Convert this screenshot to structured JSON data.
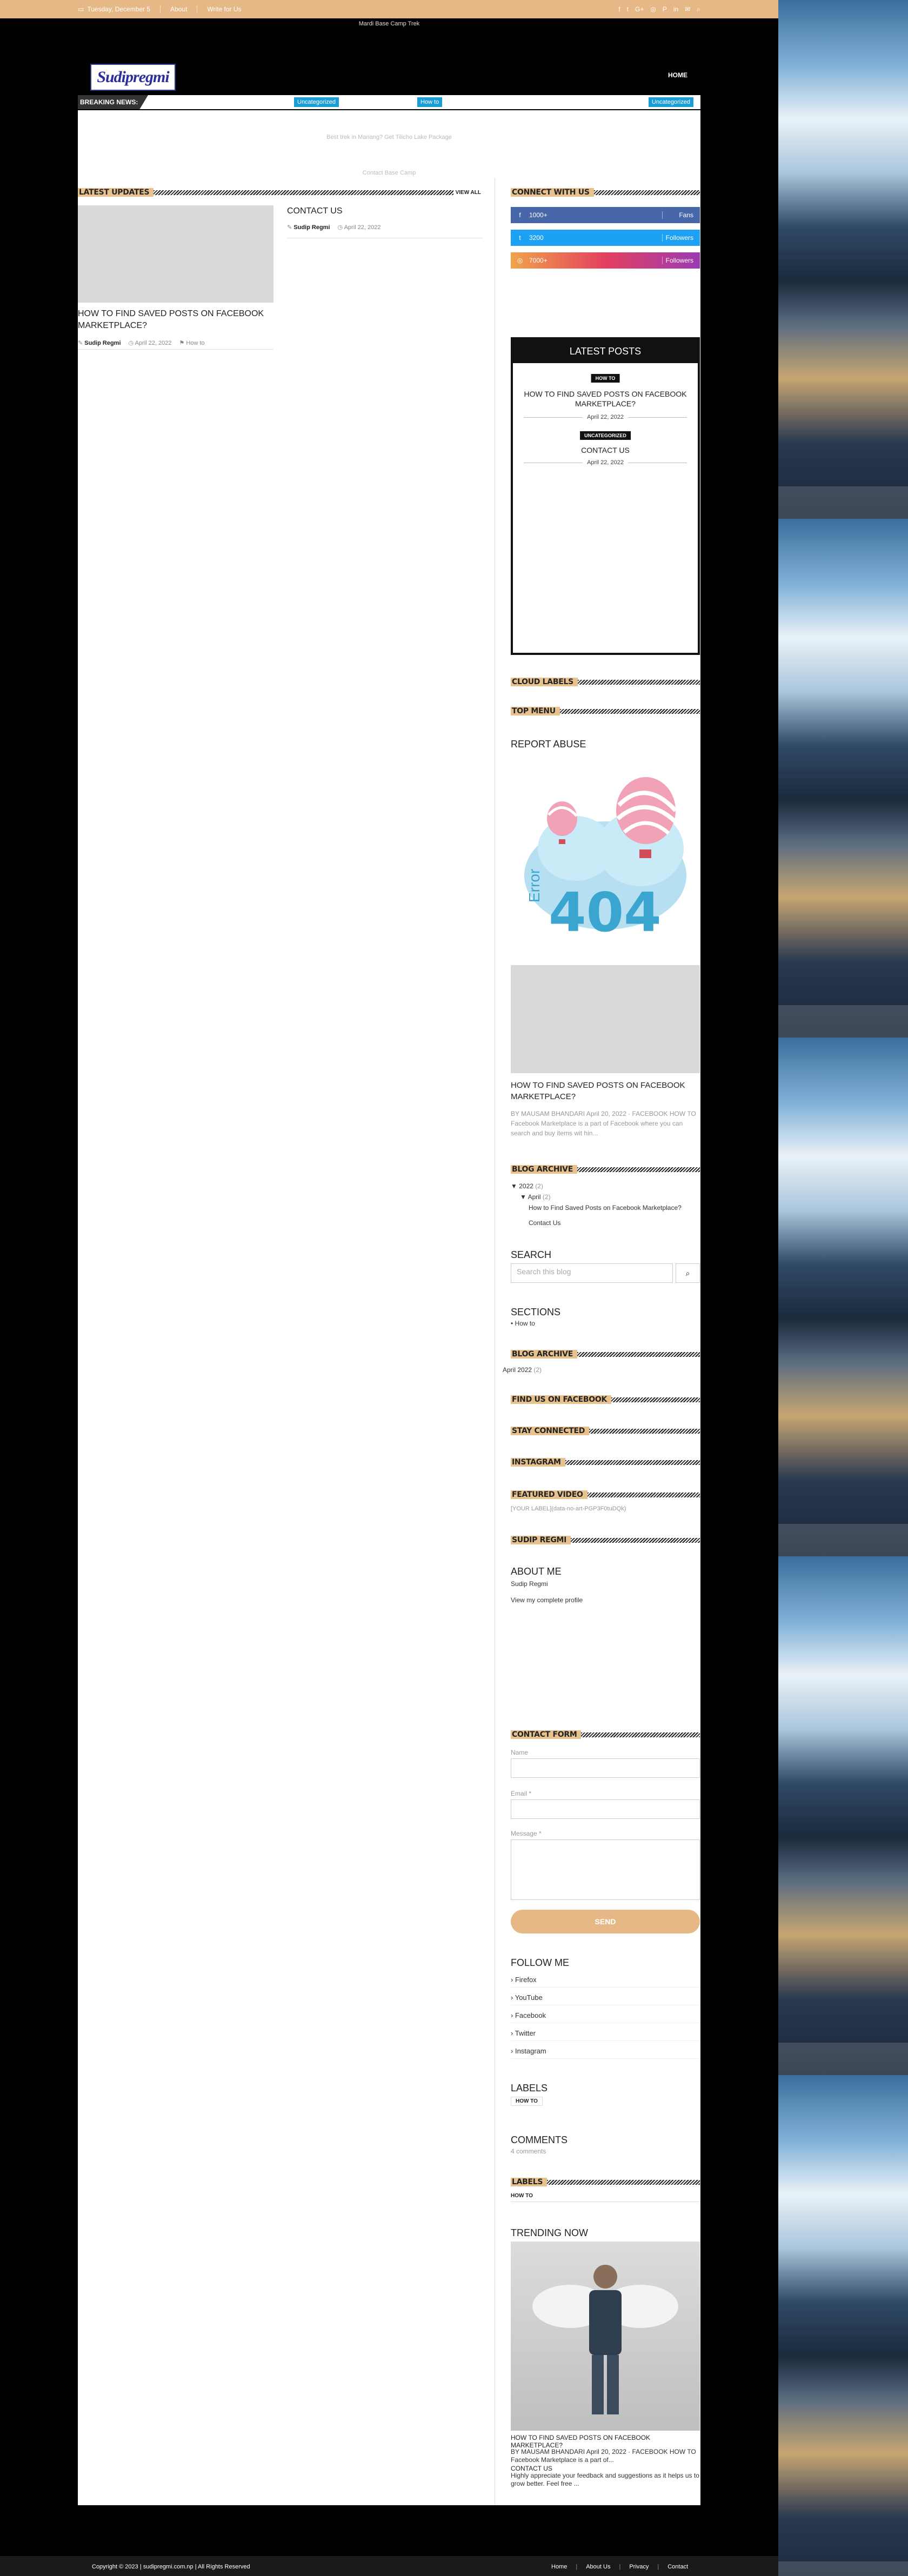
{
  "topbar": {
    "date": "Tuesday, December 5",
    "links": [
      "About",
      "Write for Us"
    ],
    "social_icons": [
      "f",
      "t",
      "G+",
      "◎",
      "P",
      "in",
      "✉",
      "⌕"
    ]
  },
  "header": {
    "strip_text": "Mardi Base Camp Trek",
    "logo": "Sudipregmi",
    "nav_home": "HOME"
  },
  "breaking": {
    "label": "BREAKING NEWS:",
    "tags": [
      "Uncategorized",
      "How to",
      "Uncategorized"
    ]
  },
  "faint_lines": [
    "Best trek in Manang? Get Tilicho Lake Package",
    "Contact Base Camp"
  ],
  "latest_updates": {
    "title": "LATEST UPDATES",
    "view_all": "VIEW ALL",
    "main_post": {
      "title": "HOW TO FIND SAVED POSTS ON FACEBOOK MARKETPLACE?",
      "author": "Sudip Regmi",
      "date": "April 22, 2022",
      "category": "How to"
    },
    "side_post": {
      "title": "CONTACT US",
      "author": "Sudip Regmi",
      "date": "April 22, 2022"
    }
  },
  "sidebar": {
    "connect_title": "CONNECT WITH US",
    "social": [
      {
        "icon": "f",
        "count": "1000+",
        "label": "Fans",
        "color": "#4867aa"
      },
      {
        "icon": "t",
        "count": "3200",
        "label": "Followers",
        "color": "#1da1f2"
      },
      {
        "icon": "◎",
        "count": "7000+",
        "label": "Followers",
        "color": "#e4405f"
      }
    ],
    "latest_posts": {
      "title": "LATEST POSTS",
      "items": [
        {
          "tag": "HOW TO",
          "title": "HOW TO FIND SAVED POSTS ON FACEBOOK MARKETPLACE?",
          "date": "April 22, 2022"
        },
        {
          "tag": "UNCATEGORIZED",
          "title": "CONTACT US",
          "date": "April 22, 2022"
        }
      ]
    },
    "cloud_labels": "CLOUD LABELS",
    "top_menu": "TOP MENU",
    "report_abuse": "REPORT ABUSE",
    "error_text": "404",
    "error_label": "Error",
    "featured": {
      "title": "HOW TO FIND SAVED POSTS ON FACEBOOK MARKETPLACE?",
      "excerpt": "BY MAUSAM BHANDARI April 20, 2022 · FACEBOOK HOW TO Facebook Marketplace is a part of Facebook where you can search and buy items wit hin..."
    },
    "blog_archive_1": {
      "title": "BLOG ARCHIVE",
      "year": "2022",
      "year_count": "(2)",
      "month": "April",
      "month_count": "(2)",
      "posts": [
        "How to Find Saved Posts on Facebook Marketplace?",
        "Contact Us"
      ]
    },
    "search": {
      "title": "SEARCH",
      "placeholder": "Search this blog"
    },
    "sections": {
      "title": "SECTIONS",
      "items": [
        "How to"
      ]
    },
    "blog_archive_2": {
      "title": "BLOG ARCHIVE",
      "item": "April 2022",
      "count": "(2)"
    },
    "find_us_fb": "FIND US ON FACEBOOK",
    "stay_connected": "STAY CONNECTED",
    "instagram": "INSTAGRAM",
    "featured_video": {
      "title": "FEATURED VIDEO",
      "text": "[YOUR LABEL](data-no-art-PGP3F0tuDQk)"
    },
    "sudip_regmi": "SUDIP REGMI",
    "about_me": {
      "title": "ABOUT ME",
      "name": "Sudip Regmi",
      "link": "View my complete profile"
    },
    "contact_form": {
      "title": "CONTACT FORM",
      "name_label": "Name",
      "name_placeholder": "",
      "email_label": "Email *",
      "email_placeholder": "",
      "message_label": "Message *",
      "send": "SEND"
    },
    "follow_me": {
      "title": "FOLLOW ME",
      "items": [
        "Firefox",
        "YouTube",
        "Facebook",
        "Twitter",
        "Instagram"
      ]
    },
    "labels": {
      "title": "LABELS",
      "chip": "HOW TO"
    },
    "comments": {
      "title": "COMMENTS",
      "text": "4 comments"
    },
    "labels2": {
      "title": "LABELS",
      "chip": "HOW TO"
    },
    "trending": {
      "title": "TRENDING NOW",
      "post_title": "HOW TO FIND SAVED POSTS ON FACEBOOK MARKETPLACE?",
      "post_meta": "BY MAUSAM BHANDARI April 20, 2022 · FACEBOOK HOW TO Facebook Marketplace is a part of...",
      "contact_title": "CONTACT US",
      "contact_excerpt": "Highly appreciate your feedback and suggestions as it helps us to grow better. Feel free ..."
    }
  },
  "footer": {
    "copyright": "Copyright © 2023 | sudipregmi.com.np | All Rights Reserved",
    "links": [
      "Home",
      "About Us",
      "Privacy",
      "Contact"
    ]
  }
}
